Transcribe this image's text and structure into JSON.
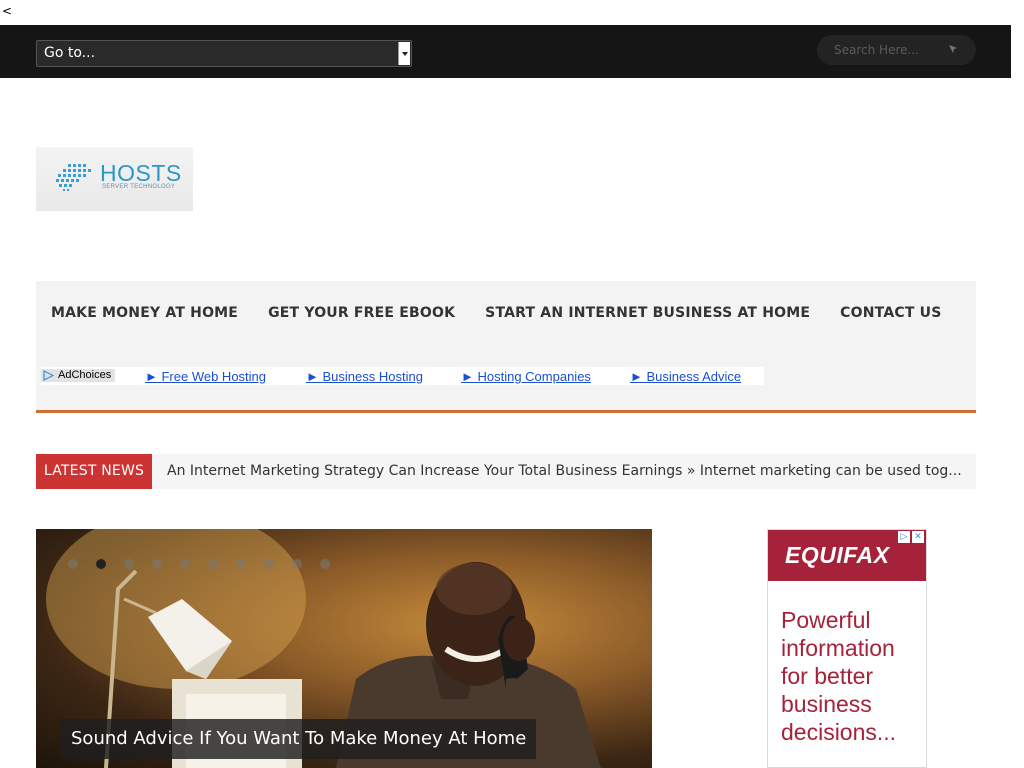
{
  "stray_char": "<",
  "topbar": {
    "goto_label": "Go to...",
    "search_placeholder": "Search Here..."
  },
  "logo": {
    "word": "HOSTS",
    "sub": "SERVER TECHNOLOGY"
  },
  "nav": {
    "items": [
      {
        "label": "MAKE MONEY AT HOME"
      },
      {
        "label": "GET YOUR FREE EBOOK"
      },
      {
        "label": "START AN INTERNET BUSINESS AT HOME"
      },
      {
        "label": "CONTACT US"
      }
    ]
  },
  "adbar": {
    "adchoices": "AdChoices",
    "links": [
      {
        "label": "► Free Web Hosting"
      },
      {
        "label": "► Business Hosting"
      },
      {
        "label": "► Hosting Companies"
      },
      {
        "label": "► Business Advice"
      }
    ]
  },
  "news": {
    "label": "LATEST NEWS",
    "text": "An Internet Marketing Strategy Can Increase Your Total Business Earnings » Internet marketing can be used tog..."
  },
  "slider": {
    "dot_count": 10,
    "active_dot": 1,
    "caption": "Sound Advice If You Want To Make Money At Home"
  },
  "side_ad": {
    "brand": "EQUIFAX",
    "icons": [
      "▷",
      "✕"
    ],
    "headline": "Powerful information for better business decisions..."
  }
}
